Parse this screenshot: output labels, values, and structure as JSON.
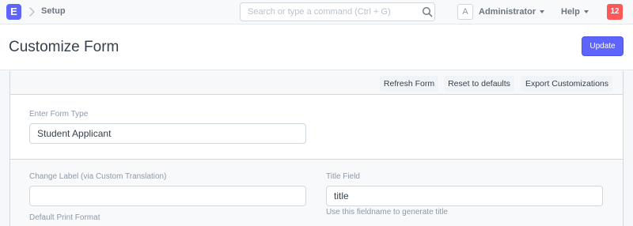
{
  "navbar": {
    "logo_letter": "E",
    "breadcrumb": "Setup",
    "search_placeholder": "Search or type a command (Ctrl + G)",
    "avatar_letter": "A",
    "user_label": "Administrator",
    "help_label": "Help",
    "notification_count": "12"
  },
  "page": {
    "title": "Customize Form",
    "update_label": "Update"
  },
  "toolbar": {
    "refresh_label": "Refresh Form",
    "reset_label": "Reset to defaults",
    "export_label": "Export Customizations"
  },
  "form": {
    "form_type_label": "Enter Form Type",
    "form_type_value": "Student Applicant",
    "change_label_label": "Change Label (via Custom Translation)",
    "change_label_value": "",
    "title_field_label": "Title Field",
    "title_field_value": "title",
    "title_field_help": "Use this fieldname to generate title",
    "print_format_label": "Default Print Format"
  },
  "colors": {
    "accent": "#5e64ff",
    "notification": "#ff5858"
  }
}
